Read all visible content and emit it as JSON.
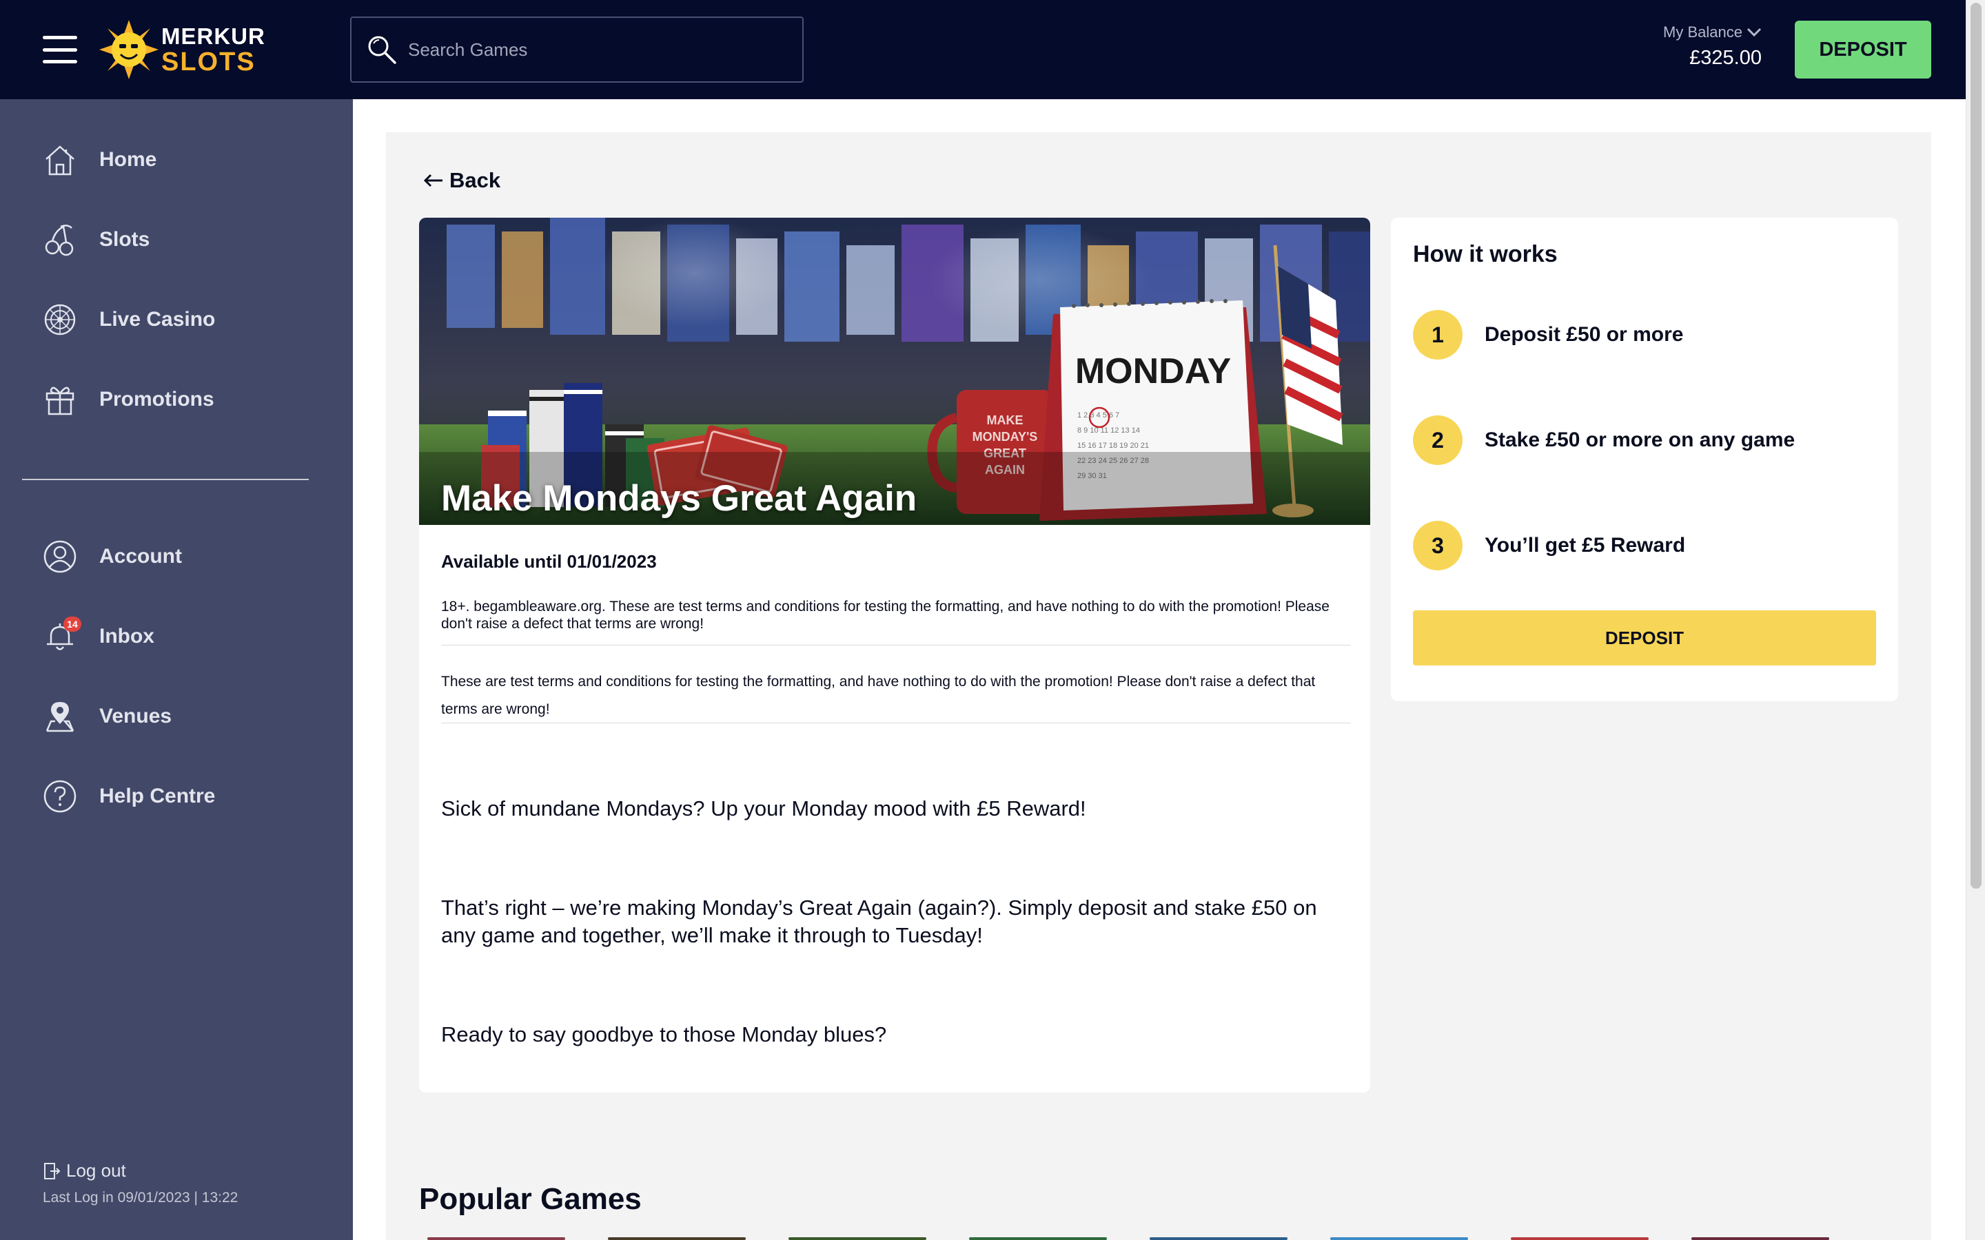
{
  "header": {
    "logo_line1": "MERKUR",
    "logo_line2": "SLOTS",
    "search_placeholder": "Search Games",
    "balance_label": "My Balance",
    "balance_amount": "£325.00",
    "deposit_label": "DEPOSIT"
  },
  "sidebar": {
    "items": [
      {
        "label": "Home",
        "icon": "home-icon"
      },
      {
        "label": "Slots",
        "icon": "cherries-icon"
      },
      {
        "label": "Live Casino",
        "icon": "roulette-icon"
      },
      {
        "label": "Promotions",
        "icon": "gift-icon"
      }
    ],
    "account_items": [
      {
        "label": "Account",
        "icon": "user-icon"
      },
      {
        "label": "Inbox",
        "icon": "bell-icon",
        "badge": "14"
      },
      {
        "label": "Venues",
        "icon": "map-pin-icon"
      },
      {
        "label": "Help Centre",
        "icon": "help-icon"
      }
    ],
    "logout_label": "Log out",
    "last_login": "Last Log in 09/01/2023 | 13:22"
  },
  "promo": {
    "back_label": "Back",
    "hero_title": "Make Mondays Great Again",
    "calendar_word": "MONDAY",
    "mug_text": "MAKE MONDAY'S GREAT AGAIN",
    "available": "Available until 01/01/2023",
    "terms1": "18+. begambleaware.org. These are test terms and conditions for testing the formatting, and have nothing to do with the promotion! Please don't raise a defect that terms are wrong!",
    "terms2": "These are test terms and conditions for testing the formatting, and have nothing to do with the promotion! Please don't raise a defect that terms are wrong!",
    "paragraphs": [
      "Sick of mundane Mondays? Up your Monday mood with £5 Reward!",
      "That’s right – we’re making Monday’s Great Again (again?). Simply deposit and stake £50 on any game and together, we’ll make it through to Tuesday!",
      "Ready to say goodbye to those Monday blues?"
    ]
  },
  "how_it_works": {
    "title": "How it works",
    "steps": [
      {
        "num": "1",
        "text": "Deposit £50 or more"
      },
      {
        "num": "2",
        "text": "Stake £50 or more on any game"
      },
      {
        "num": "3",
        "text": "You’ll get £5 Reward"
      }
    ],
    "deposit_label": "DEPOSIT"
  },
  "popular_title": "Popular Games",
  "colors": {
    "header_bg": "#050b2a",
    "sidebar_bg": "#424867",
    "deposit_green": "#72d87c",
    "accent_yellow": "#f7d657",
    "badge_red": "#e2443f"
  }
}
